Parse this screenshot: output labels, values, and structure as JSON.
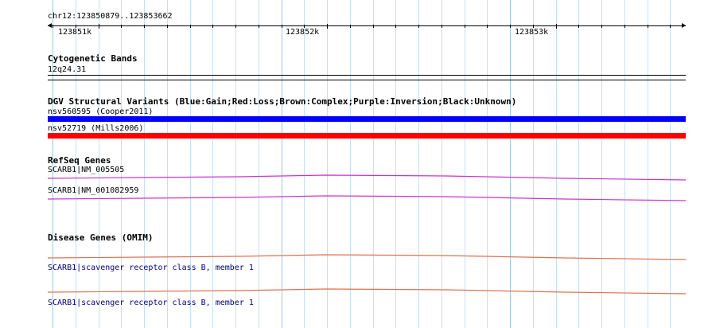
{
  "locus": "chr12:123850879..123853662",
  "ruler": {
    "labels": [
      "123851k",
      "123852k",
      "123853k"
    ]
  },
  "tracks": {
    "cytoband": {
      "title": "Cytogenetic Bands",
      "band": "12q24.31"
    },
    "dgv": {
      "title": "DGV Structural Variants (Blue:Gain;Red:Loss;Brown:Complex;Purple:Inversion;Black:Unknown)",
      "items": [
        {
          "label": "nsv560595 (Cooper2011)",
          "color": "#0000ff"
        },
        {
          "label": "nsv52719 (Mills2006)",
          "color": "#ff0000"
        }
      ]
    },
    "refseq": {
      "title": "RefSeq Genes",
      "color": "#cc33cc",
      "items": [
        {
          "label": "SCARB1|NM_005505"
        },
        {
          "label": "SCARB1|NM_001082959"
        }
      ]
    },
    "omim": {
      "title": "Disease Genes (OMIM)",
      "color": "#e07050",
      "items": [
        {
          "label": "SCARB1|scavenger receptor class B, member 1"
        },
        {
          "label": "SCARB1|scavenger receptor class B, member 1"
        }
      ]
    }
  }
}
